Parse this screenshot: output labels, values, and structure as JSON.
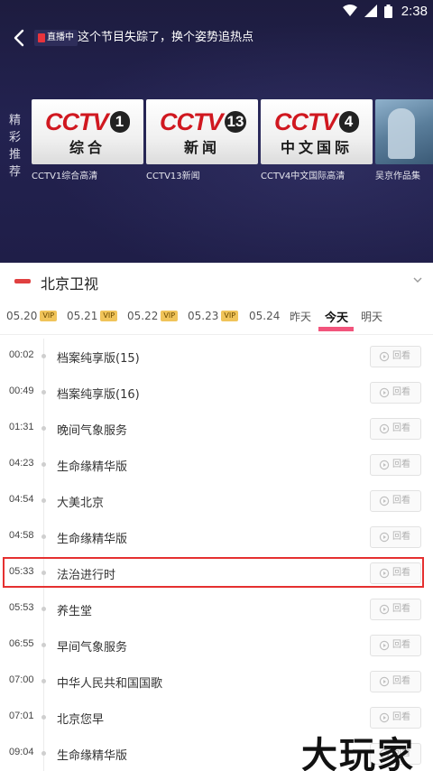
{
  "status_bar": {
    "time": "2:38"
  },
  "header": {
    "live_badge": "直播中",
    "message": "这个节目失踪了，换个姿势追热点"
  },
  "recommend": {
    "label": "精彩推荐",
    "cards": [
      {
        "logo_text": "CCTV",
        "channel_num": "1",
        "logo_sub": "综合",
        "caption": "CCTV1综合高清"
      },
      {
        "logo_text": "CCTV",
        "channel_num": "13",
        "logo_sub": "新闻",
        "caption": "CCTV13新闻"
      },
      {
        "logo_text": "CCTV",
        "channel_num": "4",
        "logo_sub": "中文国际",
        "caption": "CCTV4中文国际高清"
      },
      {
        "caption": "吴京作品集"
      }
    ]
  },
  "channel": {
    "name": "北京卫视"
  },
  "dates": [
    {
      "label": "05.20",
      "vip": "VIP"
    },
    {
      "label": "05.21",
      "vip": "VIP"
    },
    {
      "label": "05.22",
      "vip": "VIP"
    },
    {
      "label": "05.23",
      "vip": "VIP"
    },
    {
      "label": "05.24"
    },
    {
      "label": "昨天"
    },
    {
      "label": "今天",
      "active": true
    },
    {
      "label": "明天"
    }
  ],
  "programs": [
    {
      "time": "00:02",
      "title": "档案纯享版(15)",
      "action": "回看"
    },
    {
      "time": "00:49",
      "title": "档案纯享版(16)",
      "action": "回看"
    },
    {
      "time": "01:31",
      "title": "晚间气象服务",
      "action": "回看"
    },
    {
      "time": "04:23",
      "title": "生命缘精华版",
      "action": "回看"
    },
    {
      "time": "04:54",
      "title": "大美北京",
      "action": "回看"
    },
    {
      "time": "04:58",
      "title": "生命缘精华版",
      "action": "回看"
    },
    {
      "time": "05:33",
      "title": "法治进行时",
      "action": "回看",
      "highlighted": true
    },
    {
      "time": "05:53",
      "title": "养生堂",
      "action": "回看"
    },
    {
      "time": "06:55",
      "title": "早间气象服务",
      "action": "回看"
    },
    {
      "time": "07:00",
      "title": "中华人民共和国国歌",
      "action": "回看"
    },
    {
      "time": "07:01",
      "title": "北京您早",
      "action": "回看"
    },
    {
      "time": "09:04",
      "title": "生命缘精华版",
      "action": "回看"
    }
  ],
  "watermark": "大玩家",
  "colors": {
    "accent": "#f2547c",
    "highlight_border": "#e53030",
    "vip_bg": "#f0c45a",
    "top_bg": "#1f1e48"
  }
}
